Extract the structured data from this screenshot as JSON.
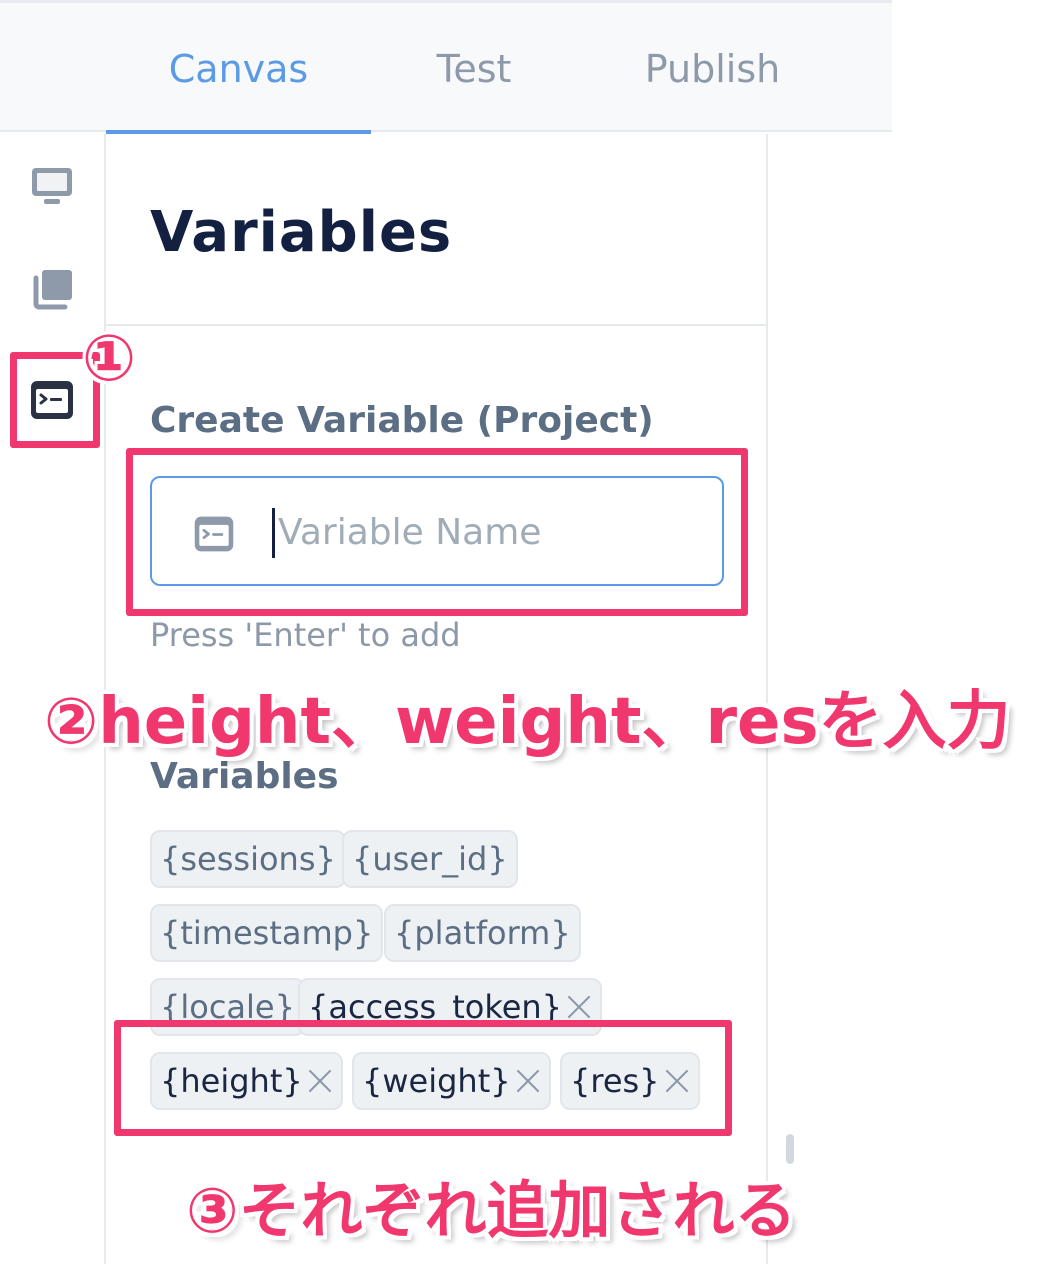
{
  "tabs": [
    {
      "label": "Canvas",
      "active": true
    },
    {
      "label": "Test",
      "active": false
    },
    {
      "label": "Publish",
      "active": false
    }
  ],
  "sidebar_icons": [
    "monitor-icon",
    "pages-stack-icon",
    "variable-icon"
  ],
  "panel": {
    "title": "Variables",
    "create_label": "Create Variable (Project)",
    "input_placeholder": "Variable Name",
    "input_icon": "variable-icon",
    "hint": "Press 'Enter' to add",
    "variables_label": "Variables"
  },
  "variables": [
    {
      "name": "{sessions}",
      "deletable": false
    },
    {
      "name": "{user_id}",
      "deletable": false
    },
    {
      "name": "{timestamp}",
      "deletable": false
    },
    {
      "name": "{platform}",
      "deletable": false
    },
    {
      "name": "{locale}",
      "deletable": false
    },
    {
      "name": "{access_token}",
      "deletable": true
    },
    {
      "name": "{height}",
      "deletable": true
    },
    {
      "name": "{weight}",
      "deletable": true
    },
    {
      "name": "{res}",
      "deletable": true
    }
  ],
  "annotations": {
    "step1": "①",
    "step2": "②height、weight、resを入力",
    "step3": "③それぞれ追加される"
  },
  "colors": {
    "accent": "#5b9ae6",
    "highlight": "#f1386e",
    "title": "#132042",
    "muted": "#8c99a8"
  }
}
